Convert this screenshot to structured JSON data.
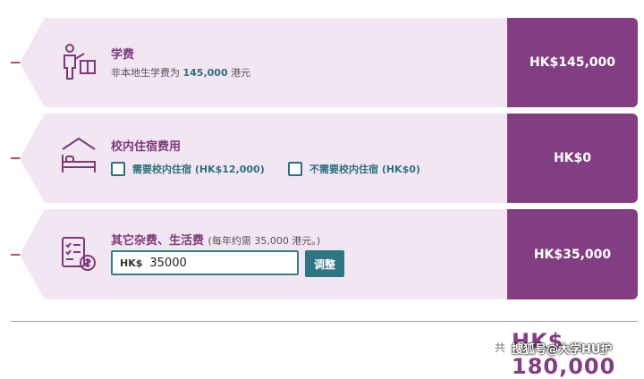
{
  "tuition": {
    "title": "学费",
    "subtitle_prefix": "非本地生学费为 ",
    "subtitle_amount": "145,000",
    "subtitle_suffix": " 港元",
    "amount": "HK$145,000"
  },
  "housing": {
    "title": "校内住宿费用",
    "option_yes": "需要校内住宿 (HK$12,000)",
    "option_no": "不需要校内住宿 (HK$0)",
    "amount": "HK$0"
  },
  "living": {
    "title": "其它杂费、生活费",
    "note": "(每年约需 35,000 港元。)",
    "input_prefix": "HK$",
    "input_value": "35000",
    "adjust_button": "调整",
    "amount": "HK$35,000"
  },
  "total": {
    "label": "共",
    "value": "HK$ 180,000"
  },
  "watermark": "搜狐号@大学HU护",
  "colors": {
    "accent_purple": "#833d82",
    "card_bg": "#f3e6f3",
    "teal": "#2f7582",
    "connector_red": "#c8486a"
  },
  "icons": {
    "tuition": "teacher-board-icon",
    "housing": "bed-house-icon",
    "living": "checklist-money-icon"
  }
}
